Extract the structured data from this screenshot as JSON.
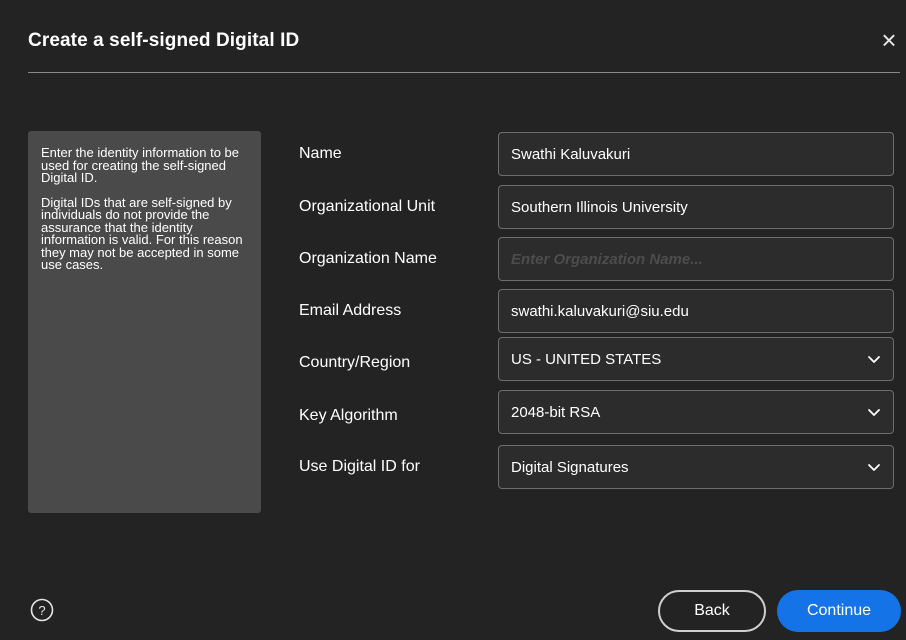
{
  "dialog": {
    "title": "Create a self-signed Digital ID",
    "close_glyph": "×"
  },
  "info_panel": {
    "paragraph1": "Enter the identity information to be used for creating the self-signed Digital ID.",
    "paragraph2": "Digital IDs that are self-signed by individuals do not provide the assurance that the identity information is valid. For this reason they may not be accepted in some use cases."
  },
  "form": {
    "name": {
      "label": "Name",
      "value": "Swathi Kaluvakuri"
    },
    "org_unit": {
      "label": "Organizational Unit",
      "value": "Southern Illinois University"
    },
    "org_name": {
      "label": "Organization Name",
      "value": "",
      "placeholder": "Enter Organization Name..."
    },
    "email": {
      "label": "Email Address",
      "value": "swathi.kaluvakuri@siu.edu"
    },
    "country": {
      "label": "Country/Region",
      "selected": "US - UNITED STATES"
    },
    "key_algorithm": {
      "label": "Key Algorithm",
      "selected": "2048-bit RSA"
    },
    "use_for": {
      "label": "Use Digital ID for",
      "selected": "Digital Signatures"
    }
  },
  "footer": {
    "help_icon": "question-circle-icon",
    "back_label": "Back",
    "continue_label": "Continue"
  },
  "colors": {
    "background": "#232323",
    "panel": "#4a4a4a",
    "accent": "#1473e6"
  }
}
